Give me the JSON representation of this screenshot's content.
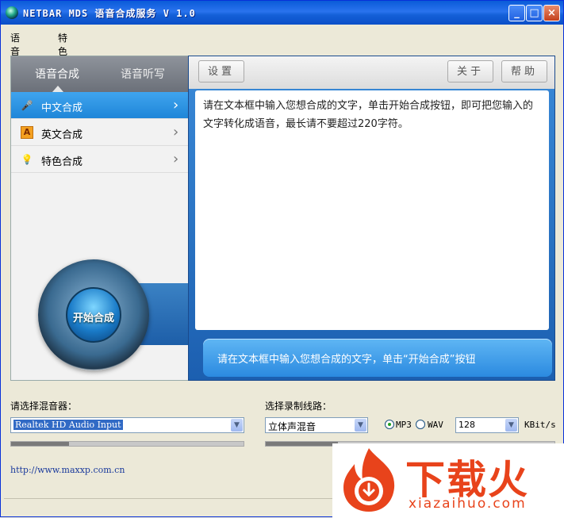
{
  "window": {
    "title": "NETBAR MDS 语音合成服务 V 1.0"
  },
  "menu": [
    "语音合成",
    "特色合成"
  ],
  "left_panel": {
    "tabs": [
      "语音合成",
      "语音听写"
    ],
    "items": [
      {
        "label": "中文合成",
        "icon": "microphone-icon",
        "active": true
      },
      {
        "label": "英文合成",
        "icon": "letter-a-icon",
        "active": false
      },
      {
        "label": "特色合成",
        "icon": "lightbulb-icon",
        "active": false
      }
    ],
    "start_button": "开始合成"
  },
  "toolbar": {
    "settings": "设置",
    "about": "关于",
    "help": "帮助"
  },
  "text_area": {
    "content": "请在文本框中输入您想合成的文字，单击开始合成按钮，即可把您输入的文字转化成语音，最长请不要超过220字符。"
  },
  "hint": "请在文本框中输入您想合成的文字，单击“开始合成”按钮",
  "mixer": {
    "label": "请选择混音器：",
    "value": "Realtek HD Audio Input",
    "level": 0.25
  },
  "line": {
    "label": "选择录制线路：",
    "value": "立体声混音",
    "level": 0.25
  },
  "format": {
    "options": [
      "MP3",
      "WAV"
    ],
    "selected": "MP3"
  },
  "bitrate": {
    "value": "128",
    "unit": "KBit/s"
  },
  "website": "http://www.maxxp.com.cn",
  "watermark": {
    "cn": "下载火",
    "en": "xiazaihuo.com"
  },
  "colors": {
    "accent": "#1f86d8",
    "titlebar": "#0a5bd8",
    "brand_orange": "#e8431b"
  }
}
